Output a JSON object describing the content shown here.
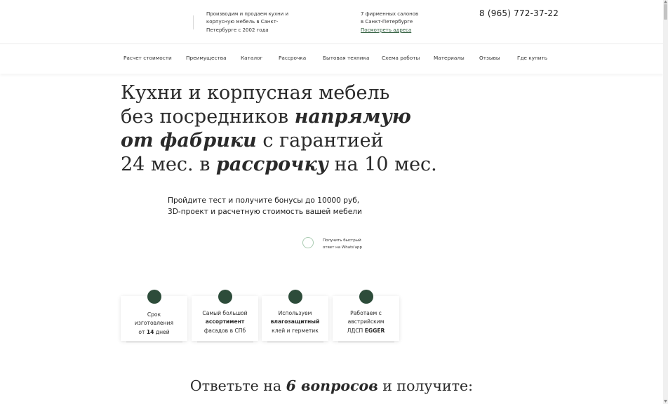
{
  "header": {
    "about": "Производим и продаем кухни и корпусную мебель в Санкт-Петербурге с 2002 года",
    "salons_line1": "7 фирменных салонов",
    "salons_line2": "в Санкт-Петербурге",
    "salons_link": "Посмотреть адреса",
    "phone": "8 (965) 772-37-22"
  },
  "nav": {
    "items": [
      {
        "label": "Расчет стоимости"
      },
      {
        "label": "Преимущества"
      },
      {
        "label": "Каталог"
      },
      {
        "label": "Рассрочка"
      },
      {
        "label": "Бытовая техника"
      },
      {
        "label": "Схема работы"
      },
      {
        "label": "Материалы"
      },
      {
        "label": "Отзывы"
      },
      {
        "label": "Где купить"
      }
    ]
  },
  "hero": {
    "line1": "Кухни и корпусная мебель",
    "line2_plain": "без посредников ",
    "line2_bold": "напрямую",
    "line3_bold": "от фабрики",
    "line3_plain": " с гарантией",
    "line4_plain1": "24 мес. в ",
    "line4_bold": "рассрочку",
    "line4_plain2": " на 10 мес."
  },
  "subtitle": {
    "line1": "Пройдите тест и получите бонусы до 10000 руб,",
    "line2": "3D-проект и расчетную стоимость вашей мебели"
  },
  "whatsapp": {
    "line1": "Получить быстрый",
    "line2": "ответ на Whats'app"
  },
  "cards": [
    {
      "parts": [
        "Срок",
        "изготовления",
        "от ",
        "14",
        " дней"
      ]
    },
    {
      "parts": [
        "Самый большой",
        "ассортимент",
        "фасадов в СПб"
      ]
    },
    {
      "parts": [
        "Используем",
        "влагозащитный",
        "клей и герметик"
      ]
    },
    {
      "parts": [
        "Работаем с",
        "австрийским",
        "ЛДСП ",
        "EGGER"
      ]
    }
  ],
  "bottom": {
    "plain1": "Ответьте на ",
    "bold": "6 вопросов",
    "plain2": " и получите:"
  },
  "colors": {
    "accent_dark_green": "#2d4c3a",
    "link_green": "#2f5d3d",
    "circle_border": "#a9cbb1"
  }
}
